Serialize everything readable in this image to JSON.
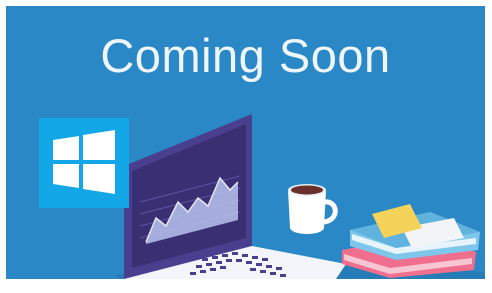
{
  "banner": {
    "heading": "Coming Soon",
    "os_logo_icon": "windows-logo-icon",
    "illustration": "laptop-desk-illustration",
    "colors": {
      "background": "#2b88c6",
      "heading_text": "#eef6fc",
      "logo_tile": "#13a7e8",
      "laptop_body": "#4a3f8e",
      "screen": "#3a2f73",
      "keyboard_deck": "#f3f5fb",
      "mug": "#ffffff",
      "coffee": "#6a2f2a",
      "book_pink": "#f06f8e",
      "book_blue": "#7ec7ea",
      "sticky_note": "#f5d25a"
    }
  }
}
